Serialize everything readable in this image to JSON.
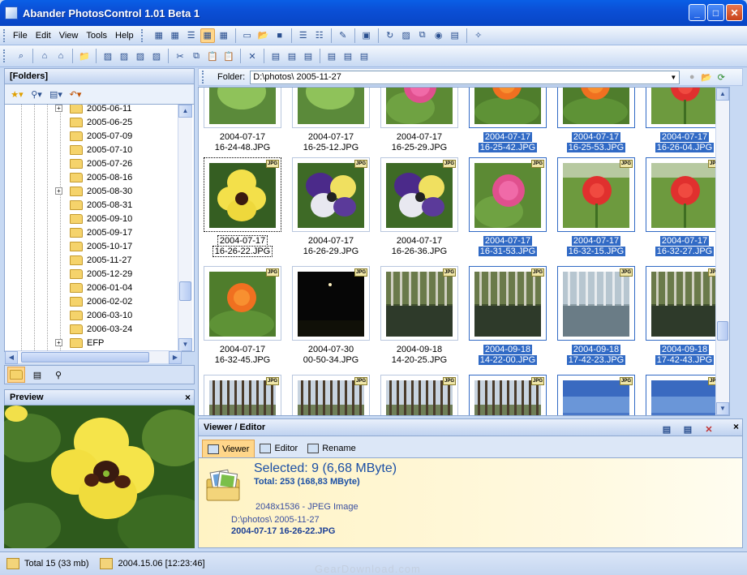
{
  "window": {
    "title": "Abander PhotosControl 1.01 Beta 1"
  },
  "menu": [
    "File",
    "Edit",
    "View",
    "Tools",
    "Help"
  ],
  "panels": {
    "folders_title": "[Folders]",
    "preview_title": "Preview",
    "viewer_title": "Viewer / Editor"
  },
  "folder_tree": [
    {
      "label": "2005-06-11",
      "expander": "+"
    },
    {
      "label": "2005-06-25",
      "expander": ""
    },
    {
      "label": "2005-07-09",
      "expander": ""
    },
    {
      "label": "2005-07-10",
      "expander": ""
    },
    {
      "label": "2005-07-26",
      "expander": ""
    },
    {
      "label": "2005-08-16",
      "expander": ""
    },
    {
      "label": "2005-08-30",
      "expander": "+"
    },
    {
      "label": "2005-08-31",
      "expander": ""
    },
    {
      "label": "2005-09-10",
      "expander": ""
    },
    {
      "label": "2005-09-17",
      "expander": ""
    },
    {
      "label": "2005-10-17",
      "expander": ""
    },
    {
      "label": "2005-11-27",
      "expander": ""
    },
    {
      "label": "2005-12-29",
      "expander": ""
    },
    {
      "label": "2006-01-04",
      "expander": ""
    },
    {
      "label": "2006-02-02",
      "expander": ""
    },
    {
      "label": "2006-03-10",
      "expander": ""
    },
    {
      "label": "2006-03-24",
      "expander": ""
    },
    {
      "label": "EFP",
      "expander": "+"
    }
  ],
  "pathbar": {
    "label": "Folder:",
    "path": "D:\\photos\\ 2005-11-27"
  },
  "thumbnails": [
    {
      "date": "2004-07-17",
      "name": "16-24-48.JPG",
      "selected": false,
      "focused": false,
      "kind": "leaf"
    },
    {
      "date": "2004-07-17",
      "name": "16-25-12.JPG",
      "selected": false,
      "focused": false,
      "kind": "leaf"
    },
    {
      "date": "2004-07-17",
      "name": "16-25-29.JPG",
      "selected": false,
      "focused": false,
      "kind": "pink"
    },
    {
      "date": "2004-07-17",
      "name": "16-25-42.JPG",
      "selected": true,
      "focused": false,
      "kind": "orange"
    },
    {
      "date": "2004-07-17",
      "name": "16-25-53.JPG",
      "selected": true,
      "focused": false,
      "kind": "orange"
    },
    {
      "date": "2004-07-17",
      "name": "16-26-04.JPG",
      "selected": true,
      "focused": false,
      "kind": "red"
    },
    {
      "date": "2004-07-17",
      "name": "16-26-22.JPG",
      "selected": false,
      "focused": true,
      "kind": "pansy-yellow"
    },
    {
      "date": "2004-07-17",
      "name": "16-26-29.JPG",
      "selected": false,
      "focused": false,
      "kind": "pansy-purple"
    },
    {
      "date": "2004-07-17",
      "name": "16-26-36.JPG",
      "selected": false,
      "focused": false,
      "kind": "pansy-purple"
    },
    {
      "date": "2004-07-17",
      "name": "16-31-53.JPG",
      "selected": true,
      "focused": false,
      "kind": "pink"
    },
    {
      "date": "2004-07-17",
      "name": "16-32-15.JPG",
      "selected": true,
      "focused": false,
      "kind": "red"
    },
    {
      "date": "2004-07-17",
      "name": "16-32-27.JPG",
      "selected": true,
      "focused": false,
      "kind": "red"
    },
    {
      "date": "2004-07-17",
      "name": "16-32-45.JPG",
      "selected": false,
      "focused": false,
      "kind": "orange"
    },
    {
      "date": "2004-07-30",
      "name": "00-50-34.JPG",
      "selected": false,
      "focused": false,
      "kind": "night"
    },
    {
      "date": "2004-09-18",
      "name": "14-20-25.JPG",
      "selected": false,
      "focused": false,
      "kind": "lake"
    },
    {
      "date": "2004-09-18",
      "name": "14-22-00.JPG",
      "selected": true,
      "focused": false,
      "kind": "lake"
    },
    {
      "date": "2004-09-18",
      "name": "17-42-23.JPG",
      "selected": true,
      "focused": false,
      "kind": "lake-light"
    },
    {
      "date": "2004-09-18",
      "name": "17-42-43.JPG",
      "selected": true,
      "focused": false,
      "kind": "lake"
    },
    {
      "date": "",
      "name": "",
      "selected": false,
      "focused": false,
      "kind": "forest"
    },
    {
      "date": "",
      "name": "",
      "selected": false,
      "focused": false,
      "kind": "forest"
    },
    {
      "date": "",
      "name": "",
      "selected": false,
      "focused": false,
      "kind": "forest"
    },
    {
      "date": "",
      "name": "",
      "selected": true,
      "focused": false,
      "kind": "forest"
    },
    {
      "date": "",
      "name": "",
      "selected": true,
      "focused": false,
      "kind": "sky"
    },
    {
      "date": "",
      "name": "",
      "selected": true,
      "focused": false,
      "kind": "sky"
    }
  ],
  "badge_text": "JPG",
  "viewer": {
    "tabs": [
      "Viewer",
      "Editor",
      "Rename"
    ],
    "selected": "Selected: 9 (6,68 MByte)",
    "total": "Total: 253 (168,83 MByte)",
    "dims": "2048x1536 - JPEG Image",
    "path": "D:\\photos\\ 2005-11-27",
    "file": "2004-07-17 16-26-22.JPG"
  },
  "status": {
    "total": "Total 15 (33 mb)",
    "date": "2004.15.06 [12:23:46]"
  },
  "watermark": "GearDownload.com",
  "colors": {
    "selection": "#316ac5",
    "title_blue": "#0b4fd6",
    "panel_blue": "#c7d9f3"
  }
}
